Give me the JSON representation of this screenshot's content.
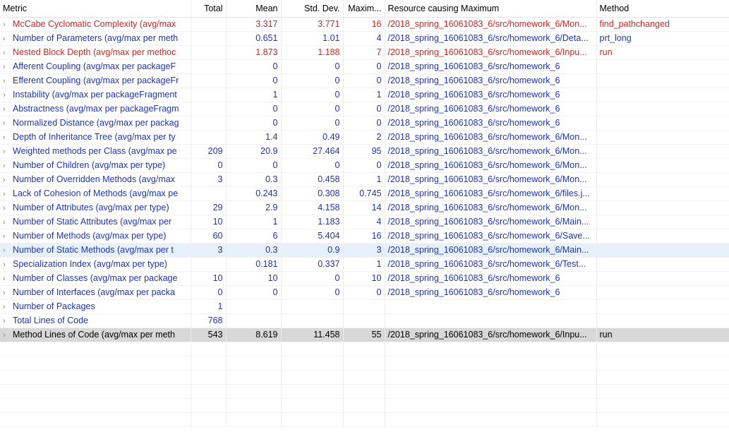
{
  "columns": {
    "metric": "Metric",
    "total": "Total",
    "mean": "Mean",
    "std": "Std. Dev.",
    "max": "Maxim...",
    "resource": "Resource causing Maximum",
    "method": "Method"
  },
  "rows": [
    {
      "metric": "McCabe Cyclomatic Complexity (avg/max",
      "total": "",
      "mean": "3.317",
      "std": "3.771",
      "max": "16",
      "resource": "/2018_spring_16061083_6/src/homework_6/Mon...",
      "method": "find_pathchanged",
      "color": "red"
    },
    {
      "metric": "Number of Parameters (avg/max per meth",
      "total": "",
      "mean": "0.651",
      "std": "1.01",
      "max": "4",
      "resource": "/2018_spring_16061083_6/src/homework_6/Deta...",
      "method": "prt_long",
      "color": "blue"
    },
    {
      "metric": "Nested Block Depth (avg/max per methoc",
      "total": "",
      "mean": "1.873",
      "std": "1.188",
      "max": "7",
      "resource": "/2018_spring_16061083_6/src/homework_6/Inpu...",
      "method": "run",
      "color": "red"
    },
    {
      "metric": "Afferent Coupling (avg/max per packageF",
      "total": "",
      "mean": "0",
      "std": "0",
      "max": "0",
      "resource": "/2018_spring_16061083_6/src/homework_6",
      "method": "",
      "color": "blue"
    },
    {
      "metric": "Efferent Coupling (avg/max per packageFr",
      "total": "",
      "mean": "0",
      "std": "0",
      "max": "0",
      "resource": "/2018_spring_16061083_6/src/homework_6",
      "method": "",
      "color": "blue"
    },
    {
      "metric": "Instability (avg/max per packageFragment",
      "total": "",
      "mean": "1",
      "std": "0",
      "max": "1",
      "resource": "/2018_spring_16061083_6/src/homework_6",
      "method": "",
      "color": "blue"
    },
    {
      "metric": "Abstractness (avg/max per packageFragm",
      "total": "",
      "mean": "0",
      "std": "0",
      "max": "0",
      "resource": "/2018_spring_16061083_6/src/homework_6",
      "method": "",
      "color": "blue"
    },
    {
      "metric": "Normalized Distance (avg/max per packag",
      "total": "",
      "mean": "0",
      "std": "0",
      "max": "0",
      "resource": "/2018_spring_16061083_6/src/homework_6",
      "method": "",
      "color": "blue"
    },
    {
      "metric": "Depth of Inheritance Tree (avg/max per ty",
      "total": "",
      "mean": "1.4",
      "std": "0.49",
      "max": "2",
      "resource": "/2018_spring_16061083_6/src/homework_6/Mon...",
      "method": "",
      "color": "blue"
    },
    {
      "metric": "Weighted methods per Class (avg/max pe",
      "total": "209",
      "mean": "20.9",
      "std": "27.464",
      "max": "95",
      "resource": "/2018_spring_16061083_6/src/homework_6/Mon...",
      "method": "",
      "color": "blue"
    },
    {
      "metric": "Number of Children (avg/max per type)",
      "total": "0",
      "mean": "0",
      "std": "0",
      "max": "0",
      "resource": "/2018_spring_16061083_6/src/homework_6/Mon...",
      "method": "",
      "color": "blue"
    },
    {
      "metric": "Number of Overridden Methods (avg/max",
      "total": "3",
      "mean": "0.3",
      "std": "0.458",
      "max": "1",
      "resource": "/2018_spring_16061083_6/src/homework_6/Mon...",
      "method": "",
      "color": "blue"
    },
    {
      "metric": "Lack of Cohesion of Methods (avg/max pe",
      "total": "",
      "mean": "0.243",
      "std": "0.308",
      "max": "0.745",
      "resource": "/2018_spring_16061083_6/src/homework_6/files.j...",
      "method": "",
      "color": "blue"
    },
    {
      "metric": "Number of Attributes (avg/max per type)",
      "total": "29",
      "mean": "2.9",
      "std": "4.158",
      "max": "14",
      "resource": "/2018_spring_16061083_6/src/homework_6/Mon...",
      "method": "",
      "color": "blue"
    },
    {
      "metric": "Number of Static Attributes (avg/max per",
      "total": "10",
      "mean": "1",
      "std": "1.183",
      "max": "4",
      "resource": "/2018_spring_16061083_6/src/homework_6/Main...",
      "method": "",
      "color": "blue"
    },
    {
      "metric": "Number of Methods (avg/max per type)",
      "total": "60",
      "mean": "6",
      "std": "5.404",
      "max": "16",
      "resource": "/2018_spring_16061083_6/src/homework_6/Save...",
      "method": "",
      "color": "blue"
    },
    {
      "metric": "Number of Static Methods (avg/max per t",
      "total": "3",
      "mean": "0.3",
      "std": "0.9",
      "max": "3",
      "resource": "/2018_spring_16061083_6/src/homework_6/Main...",
      "method": "",
      "color": "blue",
      "state": "hl"
    },
    {
      "metric": "Specialization Index (avg/max per type)",
      "total": "",
      "mean": "0.181",
      "std": "0.337",
      "max": "1",
      "resource": "/2018_spring_16061083_6/src/homework_6/Test...",
      "method": "",
      "color": "blue"
    },
    {
      "metric": "Number of Classes (avg/max per package",
      "total": "10",
      "mean": "10",
      "std": "0",
      "max": "10",
      "resource": "/2018_spring_16061083_6/src/homework_6",
      "method": "",
      "color": "blue"
    },
    {
      "metric": "Number of Interfaces (avg/max per packa",
      "total": "0",
      "mean": "0",
      "std": "0",
      "max": "0",
      "resource": "/2018_spring_16061083_6/src/homework_6",
      "method": "",
      "color": "blue"
    },
    {
      "metric": "Number of Packages",
      "total": "1",
      "mean": "",
      "std": "",
      "max": "",
      "resource": "",
      "method": "",
      "color": "blue"
    },
    {
      "metric": "Total Lines of Code",
      "total": "768",
      "mean": "",
      "std": "",
      "max": "",
      "resource": "",
      "method": "",
      "color": "blue"
    },
    {
      "metric": "Method Lines of Code (avg/max per meth",
      "total": "543",
      "mean": "8.619",
      "std": "11.458",
      "max": "55",
      "resource": "/2018_spring_16061083_6/src/homework_6/Inpu...",
      "method": "run",
      "color": "black",
      "state": "sel"
    }
  ],
  "expand_icon": "chevron-right-icon"
}
